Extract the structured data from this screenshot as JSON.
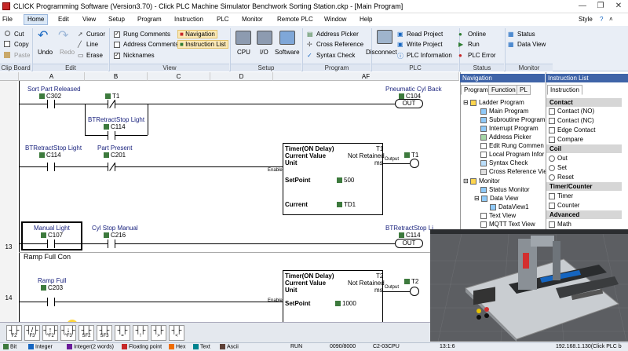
{
  "title": "CLICK Programming Software (Version3.70) - Click PLC Machine Simulator Benchwork Sorting Station.ckp - [Main Program]",
  "window": {
    "min": "—",
    "max": "❐",
    "close": "✕"
  },
  "menu": {
    "items": [
      "File",
      "Home",
      "Edit",
      "View",
      "Setup",
      "Program",
      "Instruction",
      "PLC",
      "Monitor",
      "Remote PLC",
      "Window",
      "Help"
    ],
    "style": "Style"
  },
  "ribbon": {
    "cut": "Cut",
    "copy": "Copy",
    "paste": "Paste",
    "undo": "Undo",
    "redo": "Redo",
    "cursor": "Cursor",
    "line": "Line",
    "erase": "Erase",
    "rung_comments": "Rung Comments",
    "address_comments": "Address Comments",
    "nicknames": "Nicknames",
    "navigation": "Navigation",
    "instruction_list": "Instruction List",
    "cpu": "CPU",
    "io": "I/O",
    "software": "Software",
    "address_picker": "Address Picker",
    "cross_reference": "Cross Reference",
    "syntax_check": "Syntax Check",
    "disconnect": "Disconnect",
    "read_project": "Read Project",
    "write_project": "Write Project",
    "plc_information": "PLC Information",
    "online": "Online",
    "run": "Run",
    "plc_error": "PLC Error",
    "status": "Status",
    "data_view": "Data View",
    "groups": {
      "clipboard": "Clip Board",
      "edit": "Edit",
      "view": "View",
      "setup": "Setup",
      "program": "Program",
      "plc": "PLC",
      "status": "Status",
      "monitor": "Monitor"
    }
  },
  "ladder": {
    "columns": [
      "A",
      "B",
      "C",
      "D",
      "AF"
    ],
    "rung_numbers": [
      "13",
      "14"
    ],
    "contacts": {
      "sort_part_released": {
        "nick": "Sort Part Released",
        "addr": "C302"
      },
      "t1": {
        "nick": "",
        "addr": "T1"
      },
      "btretract_c114_b": {
        "nick": "BTRetractStop Light",
        "addr": "C114"
      },
      "btretract_c114_a": {
        "nick": "BTRetractStop Light",
        "addr": "C114"
      },
      "part_present": {
        "nick": "Part Present",
        "addr": "C201"
      },
      "manual_light": {
        "nick": "Manual Light",
        "addr": "C107"
      },
      "cyl_stop_manual": {
        "nick": "Cyl Stop Manual",
        "addr": "C216"
      },
      "ramp_full": {
        "nick": "Ramp Full",
        "addr": "C203"
      }
    },
    "coils": {
      "pneumatic": {
        "nick": "Pneumatic Cyl Back",
        "addr": "C104",
        "type": "OUT"
      },
      "t1_out": {
        "addr": "T1"
      },
      "btretract_out": {
        "nick": "BTRetractStop Li",
        "addr": "C114",
        "type": "OUT"
      },
      "t2_out": {
        "addr": "T2"
      }
    },
    "timer1": {
      "title": "Timer(ON Delay)",
      "id": "T1",
      "cv": "Current Value",
      "retain": "Not Retained",
      "unit": "Unit",
      "unit_val": "ms",
      "setpoint": "SetPoint",
      "sp_val": "500",
      "current": "Current",
      "cur_val": "TD1",
      "enable": "Enable",
      "output": "Output"
    },
    "timer2": {
      "title": "Timer(ON Delay)",
      "id": "T2",
      "cv": "Current Value",
      "retain": "Not Retained",
      "unit": "Unit",
      "unit_val": "ms",
      "setpoint": "SetPoint",
      "sp_val": "1000",
      "enable": "Enable",
      "output": "Output"
    },
    "rung_comment": "Ramp Full Con"
  },
  "navigation": {
    "header": "Navigation",
    "tabs": [
      "Program",
      "Function",
      "PL"
    ],
    "items": [
      "Ladder Program",
      "Main Program",
      "Subroutine Program",
      "Interrupt Program",
      "Address Picker",
      "Edit Rung Commen",
      "Local Program Infor",
      "Syntax Check",
      "Cross Reference Vie",
      "Monitor",
      "Status Monitor",
      "Data View",
      "DataView1",
      "Text View",
      "MQTT Text View"
    ]
  },
  "instruction_list": {
    "header": "Instruction List",
    "tab": "Instruction",
    "sections": [
      {
        "name": "Contact",
        "items": [
          "Contact (NO)",
          "Contact (NC)",
          "Edge Contact",
          "Compare"
        ]
      },
      {
        "name": "Coil",
        "items": [
          "Out",
          "Set",
          "Reset"
        ]
      },
      {
        "name": "Timer/Counter",
        "items": [
          "Timer",
          "Counter"
        ]
      },
      {
        "name": "Advanced",
        "items": [
          "Math"
        ]
      }
    ]
  },
  "function_keys": [
    "F2",
    "F3",
    "^F2",
    "^F3",
    "SF2",
    "SF3",
    "=",
    "!",
    ">",
    "<"
  ],
  "status": {
    "bit": "Bit",
    "integer": "Integer",
    "integer2": "Integer(2 words)",
    "float": "Floating point",
    "hex": "Hex",
    "text": "Text",
    "ascii": "Ascii",
    "mode": "RUN",
    "steps": "0090/8000",
    "cpu": "C2-03CPU",
    "position": "13:1:6",
    "address": "192.168.1.130(Click PLC b"
  },
  "colors": {
    "ribbon_bg": "#e9eef6",
    "panel_header": "#3f64a8",
    "tag_green": "#3d7a3d"
  }
}
